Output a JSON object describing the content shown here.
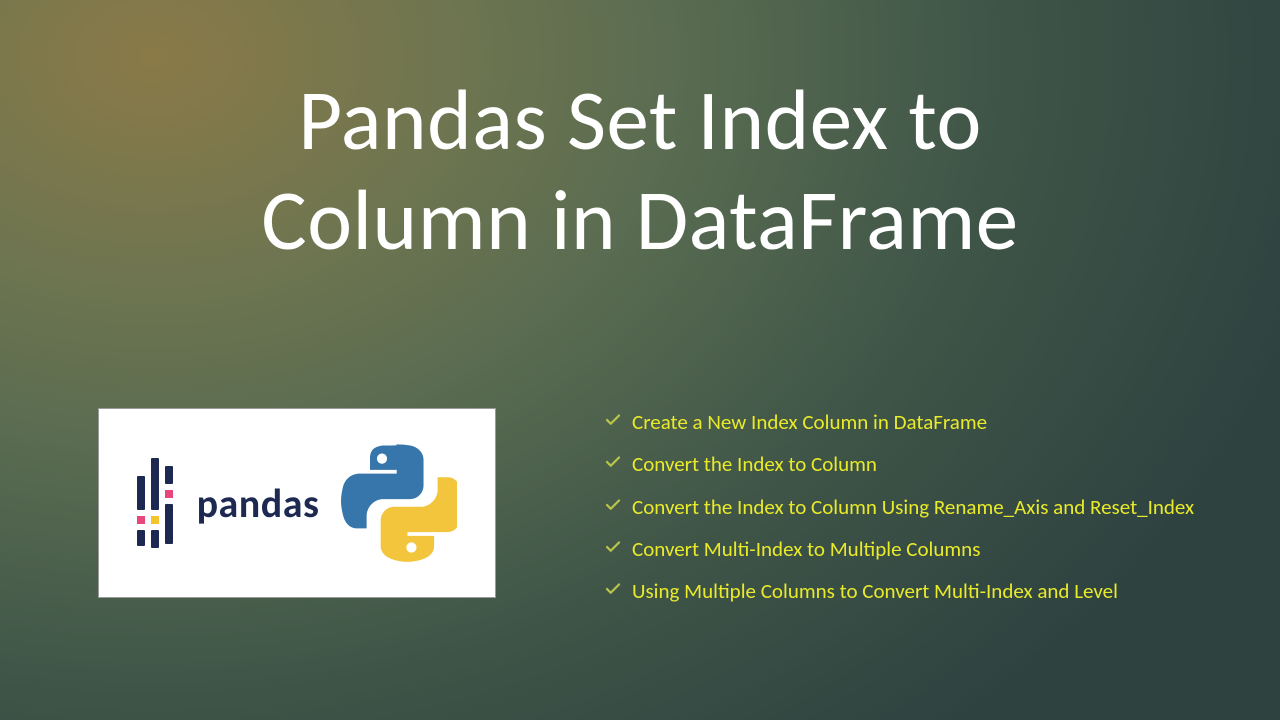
{
  "title_line1": "Pandas Set Index to",
  "title_line2": "Column in DataFrame",
  "logo_text": "pandas",
  "bullets": [
    "Create a New Index Column in DataFrame",
    "Convert the Index to Column",
    "Convert the Index to Column Using Rename_Axis and Reset_Index",
    "Convert Multi-Index to Multiple Columns",
    "Using Multiple Columns to Convert Multi-Index and Level"
  ]
}
